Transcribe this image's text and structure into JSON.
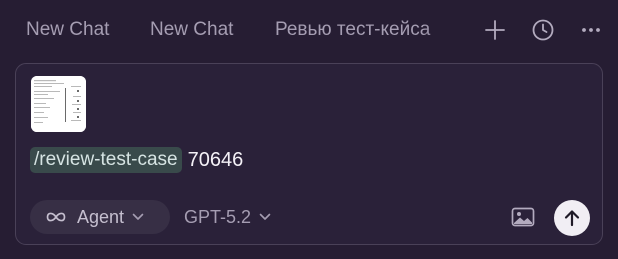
{
  "tabs": [
    {
      "label": "New Chat"
    },
    {
      "label": "New Chat"
    },
    {
      "label": "Ревью тест-кейса"
    }
  ],
  "toolbar": {
    "icons": [
      "plus-icon",
      "clock-icon",
      "more-horizontal-icon"
    ]
  },
  "composer": {
    "attachment_icon": "image-thumbnail",
    "command": "/review-test-case",
    "text": "70646",
    "mode": {
      "label": "Agent",
      "icon": "infinity-icon"
    },
    "model": {
      "label": "GPT-5.2"
    },
    "actions": [
      "image-icon",
      "arrow-up-icon"
    ]
  },
  "colors": {
    "background": "#261d33",
    "composer_bg": "#2a2139",
    "command_chip_bg": "#394a4b",
    "send_button_bg": "#f1eef4"
  }
}
